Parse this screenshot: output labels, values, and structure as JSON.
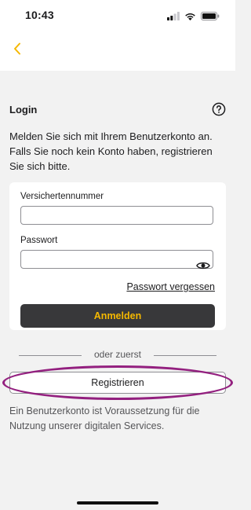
{
  "status_bar": {
    "time": "10:43",
    "icons": [
      "signal-icon",
      "wifi-icon",
      "battery-icon"
    ]
  },
  "nav": {
    "back_icon": "chevron-left-icon",
    "accent_color": "#f5b800"
  },
  "login": {
    "title": "Login",
    "help_icon": "question-circle-icon",
    "intro": "Melden Sie sich mit Ihrem Benutzerkonto an. Falls Sie noch kein Konto haben, registrieren Sie sich bitte.",
    "fields": {
      "insurance_number": {
        "label": "Versichertennummer",
        "value": "",
        "placeholder": ""
      },
      "password": {
        "label": "Passwort",
        "value": "",
        "placeholder": "",
        "toggle_icon": "eye-icon"
      }
    },
    "forgot_password": "Passwort vergessen",
    "submit_label": "Anmelden"
  },
  "divider_text": "oder zuerst",
  "register": {
    "label": "Registrieren",
    "highlight_color": "#93207f"
  },
  "footer_note": "Ein Benutzerkonto ist Voraussetzung für die Nutzung unserer digitalen Services.",
  "colors": {
    "background": "#f2f2f2",
    "button_dark": "#38383a",
    "button_text_accent": "#f5b800"
  }
}
